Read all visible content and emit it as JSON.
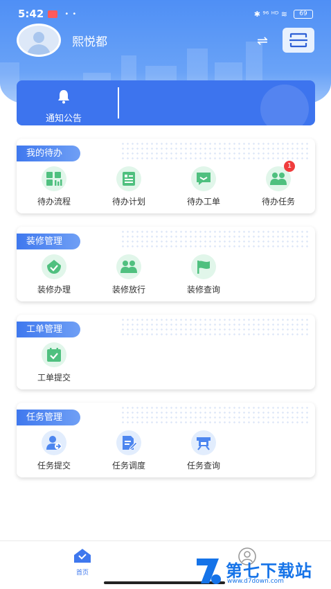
{
  "status_bar": {
    "time": "5:42",
    "dots": "• •",
    "right_glyphs": "✱ ⁹⁶ ᴴᴰ ≋",
    "battery": "69"
  },
  "profile": {
    "username": "熙悦都"
  },
  "header": {
    "switch_glyph": "⇌"
  },
  "notice": {
    "label": "通知公告"
  },
  "sections": [
    {
      "title": "我的待办",
      "items": [
        {
          "label": "待办流程",
          "icon": "workflow-grid-icon"
        },
        {
          "label": "待办计划",
          "icon": "plan-list-icon"
        },
        {
          "label": "待办工单",
          "icon": "chat-ticket-icon"
        },
        {
          "label": "待办任务",
          "icon": "people-task-icon",
          "badge": "1"
        }
      ]
    },
    {
      "title": "装修管理",
      "items": [
        {
          "label": "装修办理",
          "icon": "checkmark-drop-icon"
        },
        {
          "label": "装修放行",
          "icon": "people-release-icon"
        },
        {
          "label": "装修查询",
          "icon": "flag-icon"
        }
      ]
    },
    {
      "title": "工单管理",
      "items": [
        {
          "label": "工单提交",
          "icon": "calendar-check-icon"
        }
      ]
    },
    {
      "title": "任务管理",
      "items": [
        {
          "label": "任务提交",
          "icon": "person-submit-icon"
        },
        {
          "label": "任务调度",
          "icon": "document-edit-icon"
        },
        {
          "label": "任务查询",
          "icon": "search-doc-icon"
        }
      ]
    }
  ],
  "bottom_nav": {
    "home_label": "首页"
  },
  "watermark": {
    "title": "第七下载站",
    "url": "www.d7down.com"
  },
  "colors": {
    "primary": "#3d74ee",
    "green_icon": "#4fc07f",
    "blue_icon": "#4d86ef",
    "badge": "#f03d3d"
  }
}
